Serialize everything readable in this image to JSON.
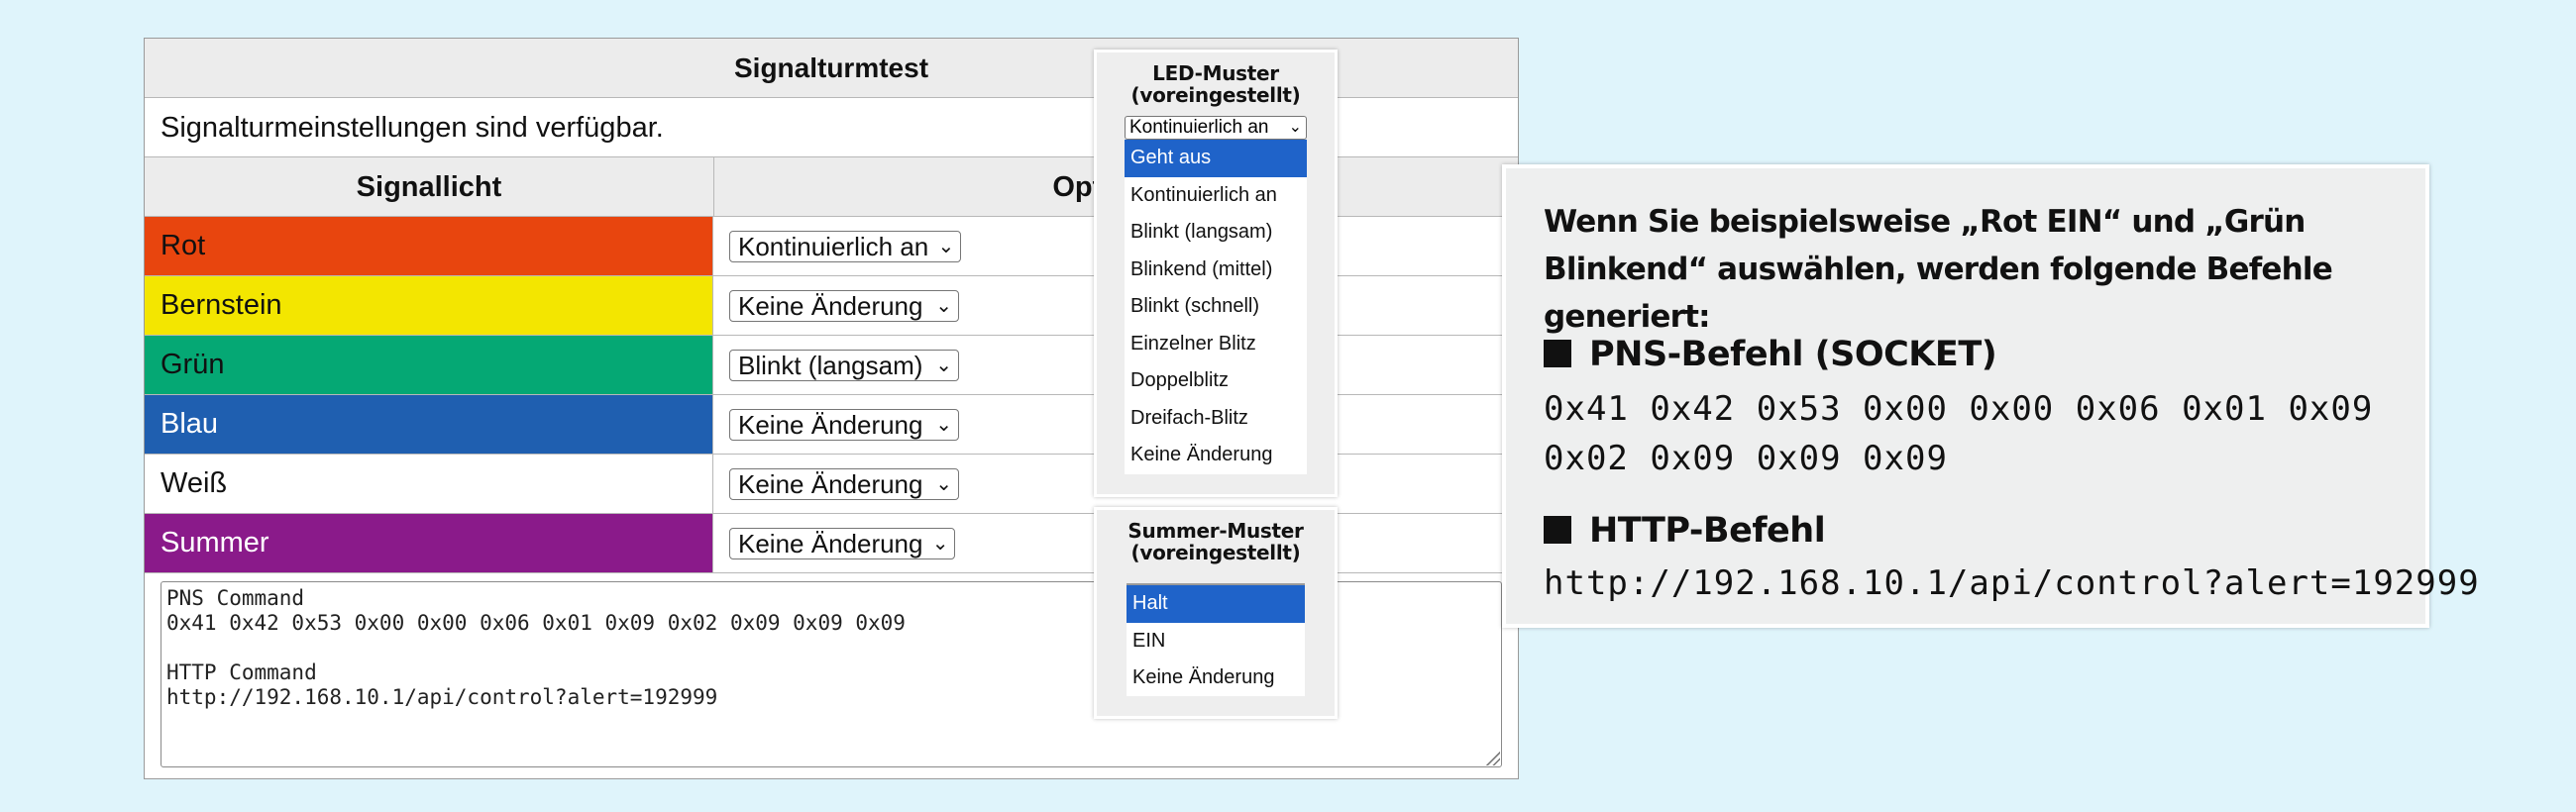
{
  "panel": {
    "title": "Signalturmtest",
    "info": "Signalturmeinstellungen sind verfügbar.",
    "col_signal": "Signallicht",
    "col_option": "Optionen"
  },
  "signals": [
    {
      "name": "Rot",
      "value": "Kontinuierlich an",
      "bg": "#e8450e",
      "fg": "#111111"
    },
    {
      "name": "Bernstein",
      "value": "Keine Änderung",
      "bg": "#f3e600",
      "fg": "#111111"
    },
    {
      "name": "Grün",
      "value": "Blinkt (langsam)",
      "bg": "#05a874",
      "fg": "#111111"
    },
    {
      "name": "Blau",
      "value": "Keine Änderung",
      "bg": "#1f5fb0",
      "fg": "#ffffff"
    },
    {
      "name": "Weiß",
      "value": "Keine Änderung",
      "bg": "#ffffff",
      "fg": "#111111"
    },
    {
      "name": "Summer",
      "value": "Keine Änderung",
      "bg": "#8a1a8a",
      "fg": "#ffffff"
    }
  ],
  "command_text": "PNS Command\n0x41 0x42 0x53 0x00 0x00 0x06 0x01 0x09 0x02 0x09 0x09 0x09\n\nHTTP Command\nhttp://192.168.10.1/api/control?alert=192999",
  "led_popup": {
    "title_line1": "LED-Muster",
    "title_line2": "(voreingestellt)",
    "selected": "Kontinuierlich an",
    "options": [
      "Geht aus",
      "Kontinuierlich an",
      "Blinkt (langsam)",
      "Blinkend (mittel)",
      "Blinkt (schnell)",
      "Einzelner Blitz",
      "Doppelblitz",
      "Dreifach-Blitz",
      "Keine Änderung"
    ],
    "highlighted_index": 0
  },
  "buzzer_popup": {
    "title_line1": "Summer-Muster",
    "title_line2": "(voreingestellt)",
    "options": [
      "Halt",
      "EIN",
      "Keine Änderung"
    ],
    "highlighted_index": 0
  },
  "info_box": {
    "intro": "Wenn Sie beispielsweise „Rot EIN“ und „Grün Blinkend“ auswählen, werden folgende Befehle generiert:",
    "pns_heading": "PNS-Befehl (SOCKET)",
    "pns_line1": "0x41 0x42 0x53 0x00 0x00 0x06 0x01 0x09",
    "pns_line2": "0x02 0x09 0x09 0x09",
    "http_heading": "HTTP-Befehl",
    "http_url": "http://192.168.10.1/api/control?alert=192999"
  }
}
